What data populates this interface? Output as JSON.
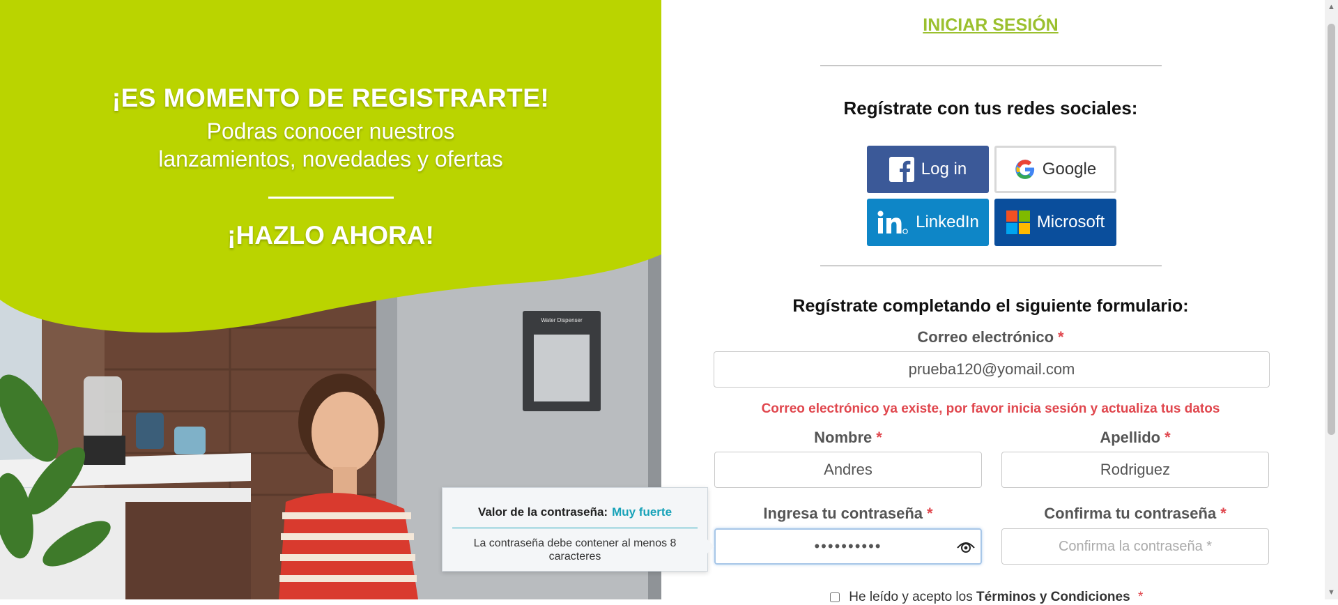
{
  "promo": {
    "heading": "¡ES MOMENTO DE REGISTRARTE!",
    "subline1": "Podras conocer nuestros",
    "subline2": "lanzamientos, novedades y ofertas",
    "cta": "¡HAZLO AHORA!",
    "fridge_label": "Water Dispenser",
    "accent_color": "#bad400"
  },
  "tooltip": {
    "strength_label": "Valor de la contraseña:",
    "strength_value": "Muy fuerte",
    "message": "La contraseña debe contener al menos 8 caracteres"
  },
  "header": {
    "login_link": "INICIAR SESIÓN"
  },
  "social": {
    "title": "Regístrate con tus redes sociales:",
    "facebook_label": "Log in",
    "google_label": "Google",
    "linkedin_label": "LinkedIn",
    "microsoft_label": "Microsoft"
  },
  "form": {
    "title": "Regístrate completando el siguiente formulario:",
    "required_mark": "*",
    "email_label": "Correo electrónico",
    "email_value": "prueba120@yomail.com",
    "email_error": "Correo electrónico ya existe, por favor inicia sesión y actualiza tus datos",
    "first_name_label": "Nombre",
    "first_name_value": "Andres",
    "last_name_label": "Apellido",
    "last_name_value": "Rodriguez",
    "password_label": "Ingresa tu contraseña",
    "password_value": "••••••••••",
    "confirm_label": "Confirma tu contraseña",
    "confirm_placeholder": "Confirma la contraseña *",
    "terms_prefix": "He leído y acepto los",
    "terms_link": "Términos y Condiciones"
  }
}
